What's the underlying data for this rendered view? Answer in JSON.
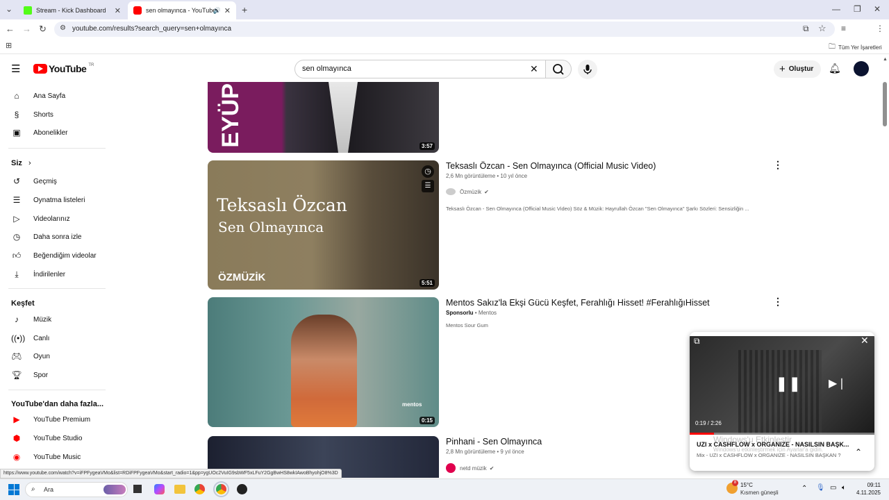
{
  "browser": {
    "tabs": [
      {
        "title": "Stream - Kick Dashboard",
        "active": false
      },
      {
        "title": "sen olmayınca - YouTube",
        "active": true
      }
    ],
    "url": "youtube.com/results?search_query=sen+olmayınca",
    "bookmarks_label": "Tüm Yer İşaretleri"
  },
  "youtube": {
    "logo_text": "YouTube",
    "region": "TR",
    "search_value": "sen olmayınca",
    "create_label": "Oluştur"
  },
  "sidebar": {
    "main": [
      {
        "label": "Ana Sayfa",
        "icon": "home-icon"
      },
      {
        "label": "Shorts",
        "icon": "shorts-icon"
      },
      {
        "label": "Abonelikler",
        "icon": "subscriptions-icon"
      }
    ],
    "you_heading": "Siz",
    "you": [
      {
        "label": "Geçmiş",
        "icon": "history-icon"
      },
      {
        "label": "Oynatma listeleri",
        "icon": "playlists-icon"
      },
      {
        "label": "Videolarınız",
        "icon": "your-videos-icon"
      },
      {
        "label": "Daha sonra izle",
        "icon": "watch-later-icon"
      },
      {
        "label": "Beğendiğim videolar",
        "icon": "liked-icon"
      },
      {
        "label": "İndirilenler",
        "icon": "downloads-icon"
      }
    ],
    "explore_heading": "Keşfet",
    "explore": [
      {
        "label": "Müzik",
        "icon": "music-icon"
      },
      {
        "label": "Canlı",
        "icon": "live-icon"
      },
      {
        "label": "Oyun",
        "icon": "gaming-icon"
      },
      {
        "label": "Spor",
        "icon": "sports-icon"
      }
    ],
    "more_heading": "YouTube'dan daha fazla...",
    "more": [
      {
        "label": "YouTube Premium",
        "icon": "yt-premium-icon"
      },
      {
        "label": "YouTube Studio",
        "icon": "yt-studio-icon"
      },
      {
        "label": "YouTube Music",
        "icon": "yt-music-icon"
      }
    ]
  },
  "results": [
    {
      "duration": "3:57",
      "thumb_text": "EYÜP"
    },
    {
      "title": "Teksaslı Özcan - Sen Olmayınca (Official Music Video)",
      "meta": "2,6 Mn görüntüleme • 10 yıl önce",
      "channel": "Özmüzik",
      "description": "Teksaslı Özcan - Sen Olmayınca (Official Music Video) Söz & Müzik: Hayrullah Özcan \"Sen Olmayınca\" Şarkı Sözleri: Sensizliğin ...",
      "duration": "5:51",
      "thumb_line1": "Teksaslı Özcan",
      "thumb_line2": "Sen Olmayınca",
      "thumb_brand": "ÖZMÜZİK"
    },
    {
      "title": "Mentos Sakız'la Ekşi Gücü Keşfet, Ferahlığı Hisset! #FerahlığıHisset",
      "sponsored": "Sponsorlu",
      "advertiser": "• Mentos",
      "description": "Mentos Sour Gum",
      "duration": "0:15",
      "thumb_brand": "mentos"
    },
    {
      "title": "Pinhani - Sen Olmayınca",
      "meta": "2,8 Mn görüntüleme • 9 yıl önce",
      "channel": "netd müzik"
    }
  ],
  "miniplayer": {
    "time": "0:19 / 2:26",
    "progress": 0.13,
    "title": "UZI x CASHFLOW x ORGANIZE - NASILSIN BAŞK...",
    "subtitle": "Mix - UZI x CASHFLOW x ORGANIZE - NASILSIN BAŞKAN ?",
    "watermark_line1": "Windows'u Etkinleştir",
    "watermark_line2": "Windows'u etkinleştirmek için Ayarlar'a gidin."
  },
  "status_url": "https://www.youtube.com/watch?v=iFPFygeaVMo&list=RDiFPFygeaVMo&start_radio=1&pp=ygUOc2VuIG9sbWF5xLFuY2GgBwHS8wkIAwoBhyohjO8%3D",
  "taskbar": {
    "search_label": "Ara",
    "weather_temp": "15°C",
    "weather_desc": "Kısmen güneşli",
    "weather_badge": "8",
    "time": "09:11",
    "date": "4.11.2025"
  }
}
